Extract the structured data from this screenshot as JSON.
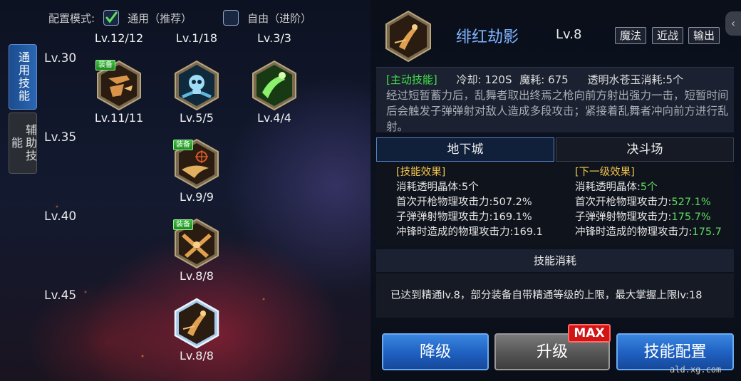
{
  "config": {
    "label": "配置模式:",
    "options": [
      {
        "label": "通用（推荐）",
        "checked": true
      },
      {
        "label": "自由（进阶）",
        "checked": false
      }
    ]
  },
  "side_tabs": [
    {
      "label": "通用技能",
      "active": true
    },
    {
      "label": "辅助技能",
      "active": false
    }
  ],
  "top_levels": [
    "Lv.12/12",
    "Lv.1/18",
    "Lv.3/3"
  ],
  "level_rows": [
    "Lv.30",
    "Lv.35",
    "Lv.40",
    "Lv.45"
  ],
  "skills": [
    {
      "level": "Lv.11/11",
      "icon": "bullet-burst-icon",
      "equipped": true,
      "equip_label": "装备",
      "color": "#c98a3a"
    },
    {
      "level": "Lv.5/5",
      "icon": "skull-guns-icon",
      "equipped": false,
      "color": "#4aa8d8"
    },
    {
      "level": "Lv.4/4",
      "icon": "green-gunner-icon",
      "equipped": false,
      "color": "#6ad85a"
    },
    {
      "level": "Lv.9/9",
      "icon": "crosshair-slash-icon",
      "equipped": true,
      "equip_label": "装备",
      "color": "#d8a24a"
    },
    {
      "level": "Lv.8/8",
      "icon": "cross-guns-icon",
      "equipped": true,
      "equip_label": "装备",
      "color": "#d8a24a"
    },
    {
      "level": "Lv.8/8",
      "icon": "crimson-shadow-icon",
      "equipped": false,
      "selected": true,
      "color": "#d8a24a"
    }
  ],
  "detail": {
    "name": "绯红劫影",
    "level": "Lv.8",
    "tags": [
      "魔法",
      "近战",
      "输出"
    ],
    "active_tag": "[主动技能]",
    "cooldown": "冷却: 120S",
    "mana": "魔耗: 675",
    "crystal": "透明水苍玉消耗:5个",
    "description": "经过短暂蓄力后，乱舞者取出终焉之枪向前方射出强力一击，短暂时间后会触发子弹弹射对敌人造成多段攻击；紧接着乱舞者冲向前方进行乱射。",
    "tabs": [
      "地下城",
      "决斗场"
    ],
    "current_header": "[技能效果]",
    "next_header": "[下一级效果]",
    "current_effects": [
      {
        "label": "消耗透明晶体:",
        "value": "5个"
      },
      {
        "label": "首次开枪物理攻击力:",
        "value": "507.2%"
      },
      {
        "label": "子弹弹射物理攻击力:",
        "value": "169.1%"
      },
      {
        "label": "冲锋时造成的物理攻击力:",
        "value": "169.1"
      }
    ],
    "next_effects": [
      {
        "label": "消耗透明晶体:",
        "value": "5个"
      },
      {
        "label": "首次开枪物理攻击力:",
        "value": "527.1%"
      },
      {
        "label": "子弹弹射物理攻击力:",
        "value": "175.7%"
      },
      {
        "label": "冲锋时造成的物理攻击力:",
        "value": "175.7"
      }
    ],
    "cost_header": "技能消耗",
    "cost_text": "已达到精通lv.8，部分装备自带精通等级的上限，最大掌握上限lv:18"
  },
  "buttons": {
    "downgrade": "降级",
    "upgrade": "升级",
    "max_badge": "MAX",
    "config": "技能配置"
  },
  "watermark": "ald.xg.com",
  "colors": {
    "accent_blue": "#2a66b3",
    "skill_name": "#7fb3ff",
    "green": "#5fd95f",
    "gold": "#f2c44c"
  }
}
